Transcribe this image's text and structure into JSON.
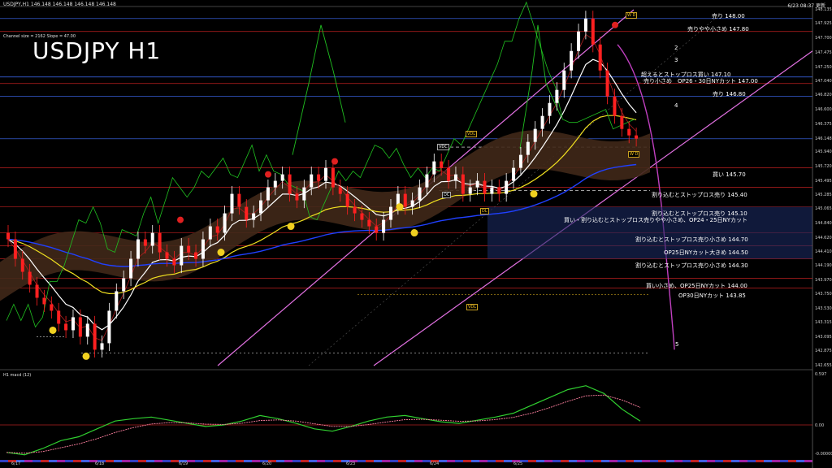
{
  "header": {
    "title": "USDJPY,H1  146.148 146.148 146.148 146.148",
    "right": "6/23 08:37 更新",
    "channel_info": "Channel size = 2162 Slope = 47.00",
    "big_title": "USDJPY H1",
    "macd_label": "H1  macd (12)"
  },
  "colors": {
    "background": "#000000",
    "bull": "#ffffff",
    "bear": "#ff2020",
    "channel": "#e070e0",
    "level_line": "#c02020",
    "blue_level": "#3060ff",
    "ma_white": "#ffffff",
    "ma_yellow": "#f0e020",
    "ma_blue": "#2040ff",
    "chikou_green": "#20c020",
    "macd_green": "#30d030",
    "macd_signal": "#ff80a0"
  },
  "annotations": [
    {
      "text": "売り 148.00"
    },
    {
      "text": "売りやや小さめ 147.80"
    },
    {
      "text": "超えるとストップロス買い 147.10"
    },
    {
      "text": "売り小さめ　OP26・30日NYカット 147.00"
    },
    {
      "text": "売り 146.80"
    },
    {
      "text": "買い 145.70"
    },
    {
      "text": "割り込むとストップロス売り 145.40"
    },
    {
      "text": "割り込むとストップロス売り 145.10"
    },
    {
      "text": "買い・割り込むとストップロス売りやや小さめ、OP24・25日NYカット"
    },
    {
      "text": "割り込むとストップロス売り小さめ 144.70"
    },
    {
      "text": "OP25日NYカット大きめ 144.50"
    },
    {
      "text": "割り込むとストップロス売り小さめ 144.30"
    },
    {
      "text": "買い小さめ、OP25日NYカット 144.00"
    },
    {
      "text": "OP30日NYカット 143.85"
    }
  ],
  "wave_labels": [
    "2",
    "3",
    "4",
    "5"
  ],
  "boxes": {
    "wd": "W D",
    "wd2": "W D",
    "vdc": "VDC",
    "dc": "DC",
    "vdl": "VDL",
    "vdl2": "VDL",
    "dl": "DL"
  },
  "price_axis": [
    "148.135",
    "147.925",
    "147.700",
    "147.475",
    "147.250",
    "147.040",
    "146.820",
    "146.600",
    "146.375",
    "146.148",
    "145.940",
    "145.720",
    "145.495",
    "145.285",
    "145.065",
    "144.840",
    "144.620",
    "144.410",
    "144.190",
    "143.970",
    "143.750",
    "143.530",
    "143.315",
    "143.095",
    "142.875",
    "142.655"
  ],
  "macd_axis": [
    "0.597",
    "0.00",
    "-0.00000"
  ],
  "date_labels": [
    "6/17",
    "6/18",
    "6/19",
    "6/20",
    "6/23",
    "6/24",
    "6/25"
  ],
  "chart_data": {
    "type": "candlestick",
    "symbol": "USDJPY",
    "timeframe": "H1",
    "ylim": [
      142.655,
      148.135
    ],
    "x_dates": [
      "6/17",
      "6/18",
      "6/19",
      "6/20",
      "6/23",
      "6/24",
      "6/25"
    ],
    "close_approx": [
      144.6,
      144.3,
      144.1,
      143.9,
      143.7,
      143.6,
      143.5,
      143.3,
      143.2,
      143.4,
      143.1,
      143.3,
      142.9,
      143.0,
      143.5,
      143.8,
      144.0,
      144.3,
      144.6,
      144.5,
      144.7,
      144.4,
      144.3,
      144.2,
      144.5,
      144.4,
      144.3,
      144.6,
      144.8,
      144.7,
      145.0,
      145.3,
      145.1,
      144.9,
      145.0,
      145.2,
      145.4,
      145.5,
      145.6,
      145.3,
      145.2,
      145.4,
      145.6,
      145.5,
      145.7,
      145.4,
      145.3,
      145.1,
      145.0,
      144.9,
      144.8,
      144.7,
      144.9,
      145.1,
      145.3,
      145.1,
      145.2,
      145.4,
      145.6,
      145.8,
      145.7,
      145.5,
      145.6,
      145.3,
      145.4,
      145.5,
      145.3,
      145.4,
      145.3,
      145.5,
      145.7,
      145.9,
      146.1,
      146.3,
      146.5,
      146.7,
      146.9,
      147.2,
      147.5,
      147.8,
      148.0,
      147.6,
      147.2,
      146.8,
      146.5,
      146.3,
      146.2,
      146.15
    ],
    "levels": [
      148.0,
      147.8,
      147.1,
      147.0,
      146.8,
      145.7,
      145.4,
      145.1,
      144.7,
      144.5,
      144.3,
      144.0,
      143.85
    ],
    "macd_approx": [
      -0.35,
      -0.38,
      -0.3,
      -0.2,
      -0.15,
      -0.05,
      0.05,
      0.08,
      0.1,
      0.06,
      0.02,
      -0.02,
      0.0,
      0.05,
      0.12,
      0.08,
      0.02,
      -0.05,
      -0.08,
      -0.02,
      0.05,
      0.1,
      0.12,
      0.08,
      0.04,
      0.02,
      0.06,
      0.1,
      0.15,
      0.25,
      0.35,
      0.45,
      0.5,
      0.4,
      0.2,
      0.05
    ]
  }
}
